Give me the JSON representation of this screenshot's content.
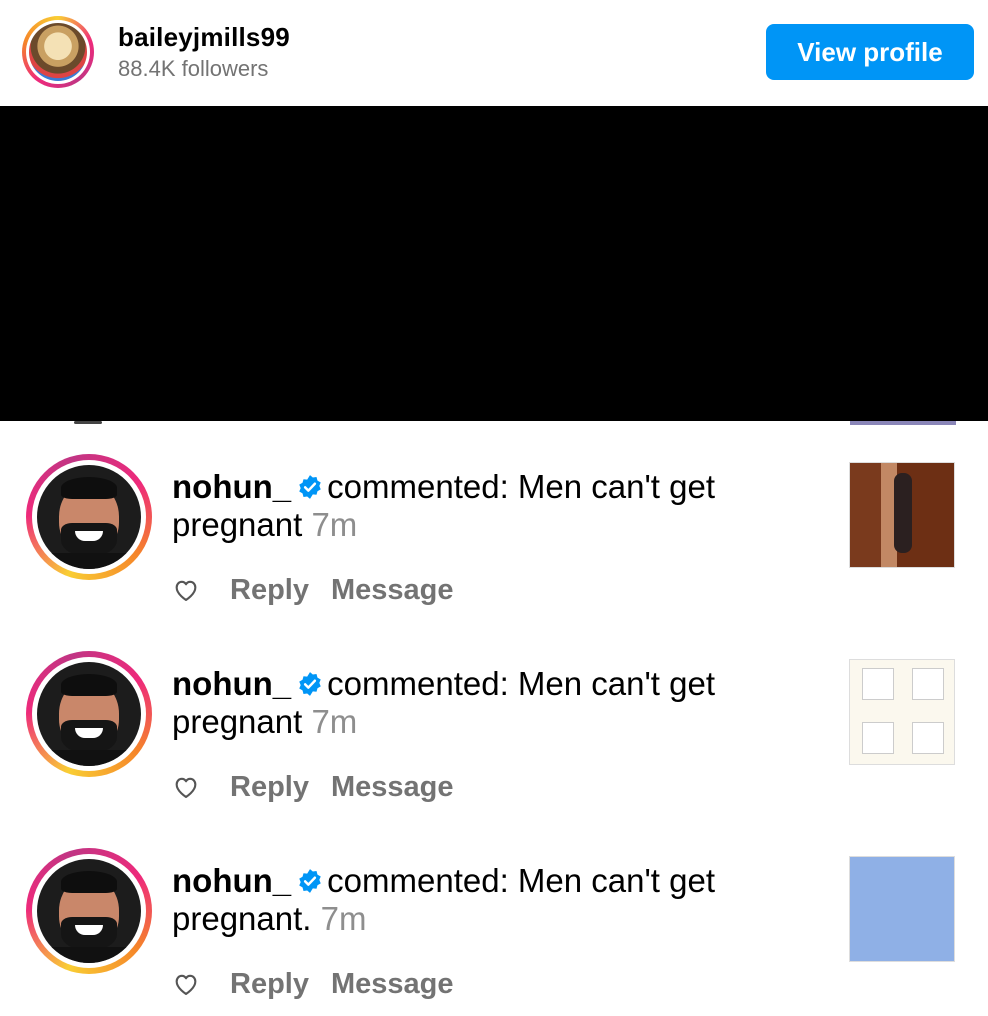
{
  "header": {
    "username": "baileyjmills99",
    "followers": "88.4K followers",
    "view_profile_label": "View profile"
  },
  "notifications": [
    {
      "username": "nohun_",
      "action": "commented: Men can't get",
      "comment_end": "pregnant",
      "time": "7m",
      "reply_label": "Reply",
      "message_label": "Message"
    },
    {
      "username": "nohun_",
      "action": "commented: Men can't get",
      "comment_end": "pregnant",
      "time": "7m",
      "reply_label": "Reply",
      "message_label": "Message"
    },
    {
      "username": "nohun_",
      "action": "commented: Men can't get",
      "comment_end": "pregnant.",
      "time": "7m",
      "reply_label": "Reply",
      "message_label": "Message"
    }
  ],
  "icons": {
    "verified": "verified-badge-icon",
    "like": "heart-icon"
  },
  "colors": {
    "accent": "#0095f6",
    "secondary_text": "#737373",
    "timestamp": "#8e8e8e"
  }
}
